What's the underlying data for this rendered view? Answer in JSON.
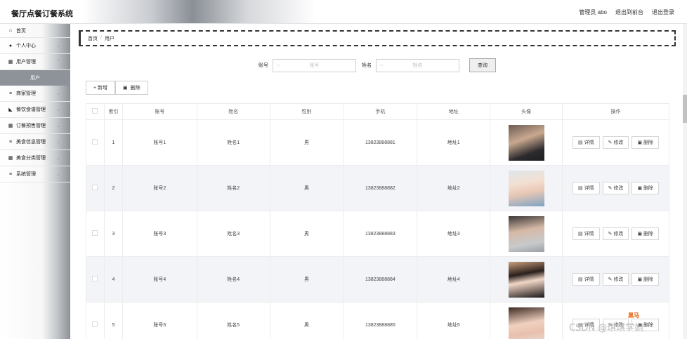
{
  "header": {
    "title": "餐厅点餐订餐系统",
    "admin": "管理员 abo",
    "front": "退出到前台",
    "logout": "退出登录"
  },
  "sidebar": {
    "items": [
      {
        "label": "首页",
        "icon": "home-icon"
      },
      {
        "label": "个人中心",
        "icon": "user-icon"
      },
      {
        "label": "用户管理",
        "icon": "grid-icon"
      },
      {
        "label": "商家管理",
        "icon": "list-icon"
      },
      {
        "label": "餐饮食谱管理",
        "icon": "shop-icon"
      },
      {
        "label": "订餐预售管理",
        "icon": "grid-icon"
      },
      {
        "label": "美食信息管理",
        "icon": "list-icon"
      },
      {
        "label": "美食分类管理",
        "icon": "grid-icon"
      },
      {
        "label": "系统管理",
        "icon": "list-icon"
      }
    ],
    "sub": "用户"
  },
  "breadcrumb": {
    "home": "首页",
    "sep": "/",
    "current": "用户"
  },
  "search": {
    "account_label": "账号",
    "account_placeholder": "账号",
    "name_label": "姓名",
    "name_placeholder": "姓名",
    "button": "查询"
  },
  "actions": {
    "add": "+ 新增",
    "delete": "删除"
  },
  "table": {
    "headers": [
      "索引",
      "账号",
      "姓名",
      "性别",
      "手机",
      "地址",
      "头像",
      "操作"
    ],
    "rows": [
      {
        "idx": "1",
        "account": "账号1",
        "name": "姓名1",
        "gender": "男",
        "phone": "13823888881",
        "addr": "地址1"
      },
      {
        "idx": "2",
        "account": "账号2",
        "name": "姓名2",
        "gender": "男",
        "phone": "13823888882",
        "addr": "地址2"
      },
      {
        "idx": "3",
        "account": "账号3",
        "name": "姓名3",
        "gender": "男",
        "phone": "13823888883",
        "addr": "地址3"
      },
      {
        "idx": "4",
        "account": "账号4",
        "name": "姓名4",
        "gender": "男",
        "phone": "13823888884",
        "addr": "地址4"
      },
      {
        "idx": "5",
        "account": "账号5",
        "name": "姓名5",
        "gender": "男",
        "phone": "13823888885",
        "addr": "地址5"
      }
    ],
    "ops": {
      "detail": "详情",
      "edit": "修改",
      "delete": "删除"
    }
  },
  "watermark": "CSDN @琪琪学姐",
  "watermark_logo": "黑马"
}
